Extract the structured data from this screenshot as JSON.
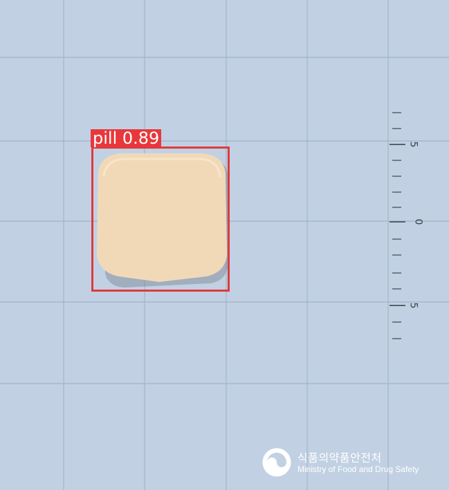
{
  "detection": {
    "label": "pill 0.89",
    "class": "pill",
    "confidence": 0.89,
    "box_color": "#e0393d"
  },
  "ruler": {
    "labels": [
      "5",
      "0",
      "5"
    ]
  },
  "pill": {
    "color": "#f1d9b8",
    "shape": "rounded-square tablet"
  },
  "watermark": {
    "korean": "식품의약품안전처",
    "english": "Ministry of Food and Drug Safety",
    "icon": "government-emblem-icon"
  },
  "colors": {
    "background": "#c1d1e3",
    "grid": "#a3b4c8"
  }
}
